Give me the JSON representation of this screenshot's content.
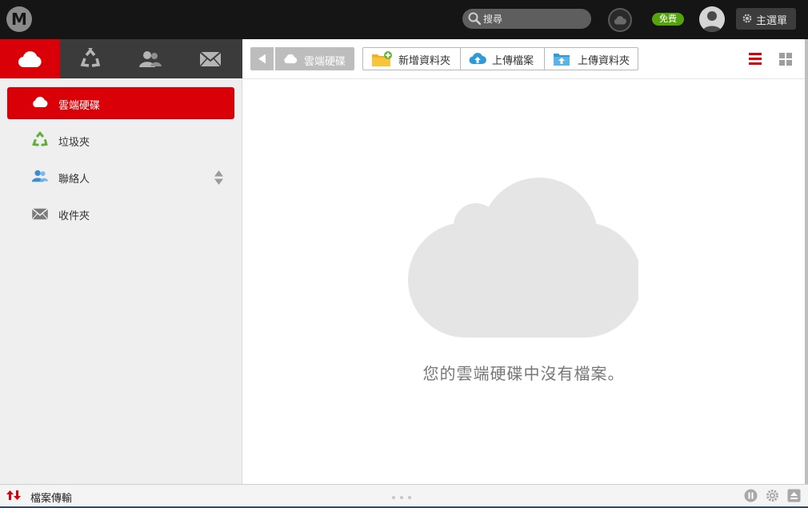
{
  "app": {
    "logo_letter": "M"
  },
  "header": {
    "search_placeholder": "搜尋",
    "free_badge": "免費",
    "menu_label": "主選單"
  },
  "nav_tabs": [
    {
      "name": "cloud-drive",
      "icon": "cloud-icon",
      "active": true
    },
    {
      "name": "rubbish-bin",
      "icon": "recycle-icon",
      "active": false
    },
    {
      "name": "contacts",
      "icon": "contacts-icon",
      "active": false
    },
    {
      "name": "inbox",
      "icon": "envelope-icon",
      "active": false
    }
  ],
  "sidebar": {
    "items": [
      {
        "label": "雲端硬碟",
        "icon": "cloud-icon",
        "active": true
      },
      {
        "label": "垃圾夾",
        "icon": "recycle-icon",
        "active": false
      },
      {
        "label": "聯絡人",
        "icon": "contacts-icon",
        "active": false
      },
      {
        "label": "收件夾",
        "icon": "envelope-icon",
        "active": false
      }
    ]
  },
  "toolbar": {
    "breadcrumb": "雲端硬碟",
    "new_folder": "新增資料夾",
    "upload_file": "上傳檔案",
    "upload_folder": "上傳資料夾"
  },
  "main": {
    "empty_message": "您的雲端硬碟中沒有檔案。"
  },
  "statusbar": {
    "transfers_label": "檔案傳輸"
  },
  "colors": {
    "accent": "#d90007",
    "free_badge": "#55a30f",
    "topbar": "#151515",
    "sidebar": "#efefef"
  }
}
